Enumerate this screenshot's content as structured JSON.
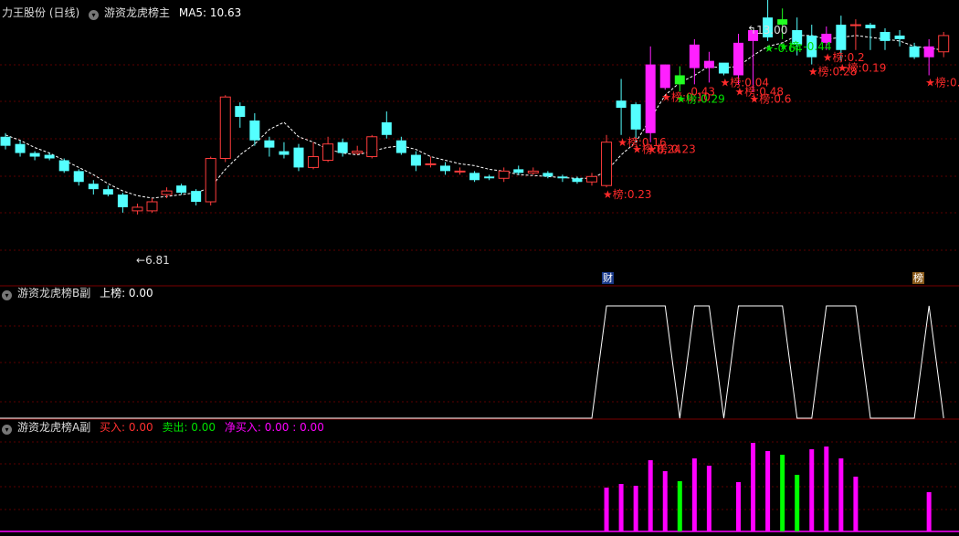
{
  "main_panel": {
    "stock_name": "力王股份 (日线)",
    "indicator_name": "游资龙虎榜主",
    "ma_label": "MA5: 10.63",
    "high_label": "13.00",
    "low_label": "6.81",
    "marker_cai": "财",
    "marker_bang": "榜"
  },
  "panel_b": {
    "indicator_name": "游资龙虎榜B副",
    "value_label": "上榜: 0.00"
  },
  "panel_a": {
    "indicator_name": "游资龙虎榜A副",
    "buy_label": "买入: 0.00",
    "sell_label": "卖出: 0.00",
    "net_label": "净买入: 0.00 : 0.00"
  },
  "colors": {
    "up": "#ff3c3c",
    "down": "#54ffff",
    "ma": "#ffffff",
    "tag_red": "#ff2a2a",
    "tag_green": "#00e000",
    "bar_magenta": "#ff00ff",
    "bar_green": "#00ff00",
    "grid": "#5a0000"
  },
  "chart_data": {
    "type": "candlestick",
    "candles": [
      [
        10.05,
        9.8,
        10.15,
        9.7
      ],
      [
        9.85,
        9.6,
        9.95,
        9.5
      ],
      [
        9.6,
        9.5,
        9.65,
        9.4
      ],
      [
        9.55,
        9.45,
        9.6,
        9.4
      ],
      [
        9.4,
        9.1,
        9.45,
        9.05
      ],
      [
        9.1,
        8.8,
        9.15,
        8.7
      ],
      [
        8.75,
        8.6,
        8.85,
        8.45
      ],
      [
        8.6,
        8.45,
        8.7,
        8.4
      ],
      [
        8.45,
        8.1,
        8.5,
        7.95
      ],
      [
        8.0,
        8.1,
        8.2,
        7.9
      ],
      [
        8.0,
        8.25,
        8.35,
        7.95
      ],
      [
        8.45,
        8.55,
        8.65,
        8.35
      ],
      [
        8.7,
        8.5,
        8.75,
        8.45
      ],
      [
        8.55,
        8.25,
        8.6,
        8.15
      ],
      [
        8.25,
        9.45,
        9.5,
        8.15
      ],
      [
        9.45,
        11.15,
        11.2,
        9.35
      ],
      [
        10.9,
        10.6,
        11.0,
        10.3
      ],
      [
        10.5,
        9.95,
        10.7,
        9.8
      ],
      [
        9.95,
        9.75,
        10.05,
        9.5
      ],
      [
        9.65,
        9.55,
        9.9,
        9.45
      ],
      [
        9.75,
        9.2,
        9.85,
        9.1
      ],
      [
        9.2,
        9.5,
        9.9,
        9.15
      ],
      [
        9.4,
        9.85,
        10.05,
        9.35
      ],
      [
        9.9,
        9.6,
        10.0,
        9.5
      ],
      [
        9.6,
        9.65,
        9.8,
        9.55
      ],
      [
        9.5,
        10.05,
        10.1,
        9.45
      ],
      [
        10.45,
        10.1,
        10.75,
        10.0
      ],
      [
        9.95,
        9.6,
        10.05,
        9.55
      ],
      [
        9.55,
        9.25,
        9.65,
        9.1
      ],
      [
        9.3,
        9.3,
        9.5,
        9.2
      ],
      [
        9.25,
        9.1,
        9.35,
        9.0
      ],
      [
        9.1,
        9.1,
        9.2,
        9.0
      ],
      [
        9.05,
        8.85,
        9.1,
        8.8
      ],
      [
        8.95,
        8.9,
        9.0,
        8.85
      ],
      [
        8.9,
        9.1,
        9.2,
        8.8
      ],
      [
        9.15,
        9.05,
        9.25,
        9.0
      ],
      [
        9.05,
        9.1,
        9.2,
        9.0
      ],
      [
        9.05,
        8.95,
        9.1,
        8.9
      ],
      [
        8.95,
        8.9,
        9.0,
        8.8
      ],
      [
        8.9,
        8.8,
        8.95,
        8.75
      ],
      [
        8.8,
        8.95,
        9.05,
        8.7
      ],
      [
        8.7,
        9.9,
        10.1,
        8.65
      ],
      [
        11.05,
        10.85,
        11.65,
        10.1
      ],
      [
        10.95,
        10.25,
        11.0,
        9.9
      ],
      [
        10.15,
        12.05,
        12.55,
        9.9
      ],
      [
        11.4,
        12.05,
        12.05,
        11.35
      ],
      [
        11.75,
        11.5,
        12.0,
        11.3
      ],
      [
        11.95,
        12.6,
        12.75,
        11.5
      ],
      [
        11.95,
        12.15,
        12.4,
        11.55
      ],
      [
        12.1,
        11.8,
        12.05,
        11.75
      ],
      [
        11.75,
        12.65,
        12.9,
        11.5
      ],
      [
        12.7,
        13.0,
        13.0,
        11.3
      ],
      [
        13.35,
        12.8,
        13.9,
        12.7
      ],
      [
        13.3,
        13.15,
        13.6,
        12.75
      ],
      [
        13.0,
        12.6,
        13.35,
        12.3
      ],
      [
        12.85,
        12.25,
        13.15,
        12.05
      ],
      [
        12.65,
        12.9,
        13.1,
        12.45
      ],
      [
        13.15,
        12.45,
        13.4,
        12.15
      ],
      [
        13.15,
        13.15,
        13.3,
        12.45
      ],
      [
        13.15,
        13.05,
        13.2,
        12.45
      ],
      [
        12.95,
        12.7,
        13.05,
        12.45
      ],
      [
        12.85,
        12.75,
        13.0,
        12.55
      ],
      [
        12.55,
        12.25,
        12.65,
        12.2
      ],
      [
        12.25,
        12.55,
        12.75,
        11.75
      ],
      [
        12.4,
        12.85,
        12.95,
        12.25
      ]
    ],
    "ma5": [
      10.1,
      9.95,
      9.75,
      9.6,
      9.4,
      9.2,
      9.0,
      8.75,
      8.55,
      8.42,
      8.35,
      8.4,
      8.45,
      8.5,
      8.65,
      9.15,
      9.55,
      9.85,
      10.25,
      10.45,
      10.05,
      9.9,
      9.7,
      9.6,
      9.55,
      9.65,
      9.75,
      9.8,
      9.7,
      9.5,
      9.4,
      9.3,
      9.25,
      9.15,
      9.1,
      9.0,
      8.98,
      8.95,
      8.92,
      8.9,
      8.9,
      9.1,
      9.55,
      9.9,
      10.55,
      11.2,
      11.55,
      11.75,
      12.0,
      11.95,
      12.0,
      12.3,
      12.55,
      12.65,
      12.85,
      12.85,
      12.75,
      12.8,
      12.85,
      12.8,
      12.75,
      12.7,
      12.55,
      12.5,
      12.45
    ],
    "labels_main": [
      {
        "i": 41,
        "text": "★榜:0.23",
        "color": "red"
      },
      {
        "i": 42,
        "text": "★榜:0.16",
        "color": "red"
      },
      {
        "i": 43,
        "text": "★榜:0.24",
        "color": "red"
      },
      {
        "i": 44,
        "text": "★榜:0.23",
        "color": "red"
      },
      {
        "i": 45,
        "text": "★榜:0.10",
        "color": "red"
      },
      {
        "i": 46,
        "text": "★榜:0.29",
        "color": "green"
      },
      {
        "i": 47,
        "text": "0.43",
        "color": "red"
      },
      {
        "i": 49,
        "text": "★榜:0.04",
        "color": "red"
      },
      {
        "i": 50,
        "text": "★榜:0.48",
        "color": "red"
      },
      {
        "i": 51,
        "text": "★榜:0.6",
        "color": "red"
      },
      {
        "i": 52,
        "text": "★-0.64",
        "color": "green"
      },
      {
        "i": 53,
        "text": "★榜:-0.44",
        "color": "green"
      },
      {
        "i": 55,
        "text": "★榜:0.28",
        "color": "red"
      },
      {
        "i": 56,
        "text": "★榜:0.2",
        "color": "red"
      },
      {
        "i": 57,
        "text": "★榜:0.19",
        "color": "red"
      },
      {
        "i": 63,
        "text": "★榜:0.1",
        "color": "red"
      }
    ],
    "b_series": [
      0,
      0,
      0,
      0,
      0,
      0,
      0,
      0,
      0,
      0,
      0,
      0,
      0,
      0,
      0,
      0,
      0,
      0,
      0,
      0,
      0,
      0,
      0,
      0,
      0,
      0,
      0,
      0,
      0,
      0,
      0,
      0,
      0,
      0,
      0,
      0,
      0,
      0,
      0,
      0,
      0,
      1,
      1,
      1,
      1,
      1,
      0,
      1,
      1,
      0,
      1,
      1,
      1,
      1,
      0,
      0,
      1,
      1,
      1,
      0,
      0,
      0,
      0,
      1,
      0
    ],
    "a_bars": [
      {
        "i": 41,
        "v": 0.48,
        "c": "magenta"
      },
      {
        "i": 42,
        "v": 0.52,
        "c": "magenta"
      },
      {
        "i": 43,
        "v": 0.5,
        "c": "magenta"
      },
      {
        "i": 44,
        "v": 0.78,
        "c": "magenta"
      },
      {
        "i": 45,
        "v": 0.66,
        "c": "magenta"
      },
      {
        "i": 46,
        "v": 0.55,
        "c": "green"
      },
      {
        "i": 47,
        "v": 0.8,
        "c": "magenta"
      },
      {
        "i": 48,
        "v": 0.72,
        "c": "magenta"
      },
      {
        "i": 50,
        "v": 0.54,
        "c": "magenta"
      },
      {
        "i": 51,
        "v": 0.97,
        "c": "magenta"
      },
      {
        "i": 52,
        "v": 0.88,
        "c": "magenta"
      },
      {
        "i": 53,
        "v": 0.84,
        "c": "green"
      },
      {
        "i": 54,
        "v": 0.62,
        "c": "green"
      },
      {
        "i": 55,
        "v": 0.9,
        "c": "magenta"
      },
      {
        "i": 56,
        "v": 0.93,
        "c": "magenta"
      },
      {
        "i": 57,
        "v": 0.8,
        "c": "magenta"
      },
      {
        "i": 58,
        "v": 0.6,
        "c": "magenta"
      },
      {
        "i": 63,
        "v": 0.43,
        "c": "magenta"
      }
    ]
  }
}
